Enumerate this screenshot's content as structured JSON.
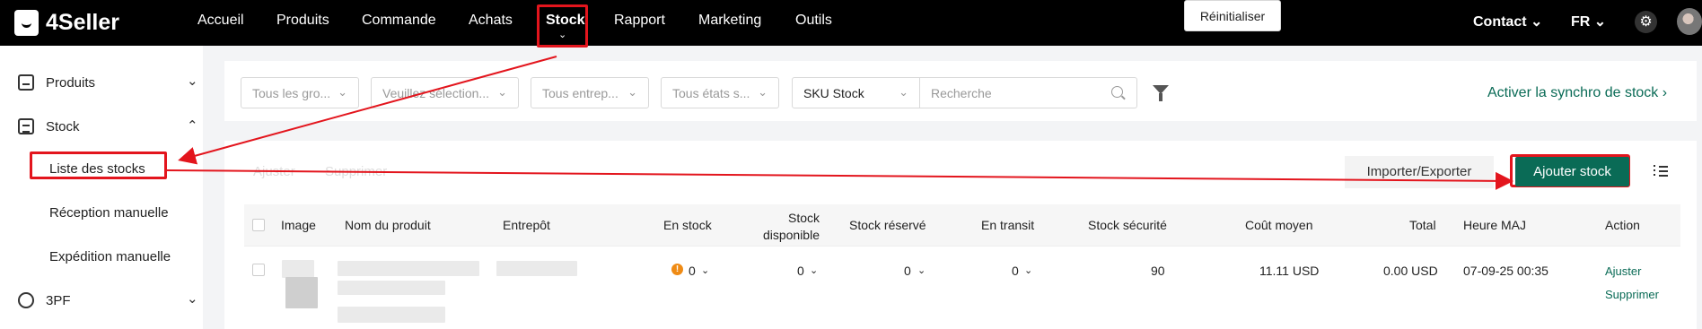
{
  "header": {
    "brand": "4Seller",
    "nav": [
      "Accueil",
      "Produits",
      "Commande",
      "Achats",
      "Stock",
      "Rapport",
      "Marketing",
      "Outils"
    ],
    "contact": "Contact",
    "language": "FR",
    "settings_icon": "gear-icon",
    "avatar_icon": "avatar"
  },
  "sidebar": {
    "groups": [
      {
        "label": "Produits",
        "icon": "product-box-icon"
      },
      {
        "label": "Stock",
        "icon": "stock-icon"
      },
      {
        "label": "3PF",
        "icon": "globe-icon"
      }
    ],
    "stock_items": [
      "Liste des stocks",
      "Réception manuelle",
      "Expédition manuelle"
    ]
  },
  "filters": {
    "groups_placeholder": "Tous les gro...",
    "selection_placeholder": "Veuillez sélection...",
    "warehouse_placeholder": "Tous entrep...",
    "status_placeholder": "Tous états s...",
    "search_type": "SKU Stock",
    "search_placeholder": "Recherche",
    "reset_label": "Réinitialiser",
    "sync_link": "Activer la synchro de stock ›"
  },
  "toolbar": {
    "adjust_label": "Ajuster",
    "delete_label": "Supprimer",
    "import_export_label": "Importer/Exporter",
    "add_stock_label": "Ajouter stock"
  },
  "table": {
    "columns": [
      "Image",
      "Nom du produit",
      "Entrepôt",
      "En stock",
      "Stock disponible",
      "Stock réservé",
      "En transit",
      "Stock sécurité",
      "Coût moyen",
      "Total",
      "Heure MAJ",
      "Action"
    ],
    "row": {
      "in_stock": "0",
      "available": "0",
      "reserved": "0",
      "in_transit": "0",
      "safety_stock": "90",
      "average_cost": "11.11 USD",
      "total": "0.00 USD",
      "updated_at": "07-09-25 00:35",
      "action_adjust": "Ajuster",
      "action_delete": "Supprimer"
    }
  },
  "colors": {
    "brand_green": "#0a6b56",
    "highlight_red": "#e3151d",
    "warning_orange": "#ef8b15"
  }
}
